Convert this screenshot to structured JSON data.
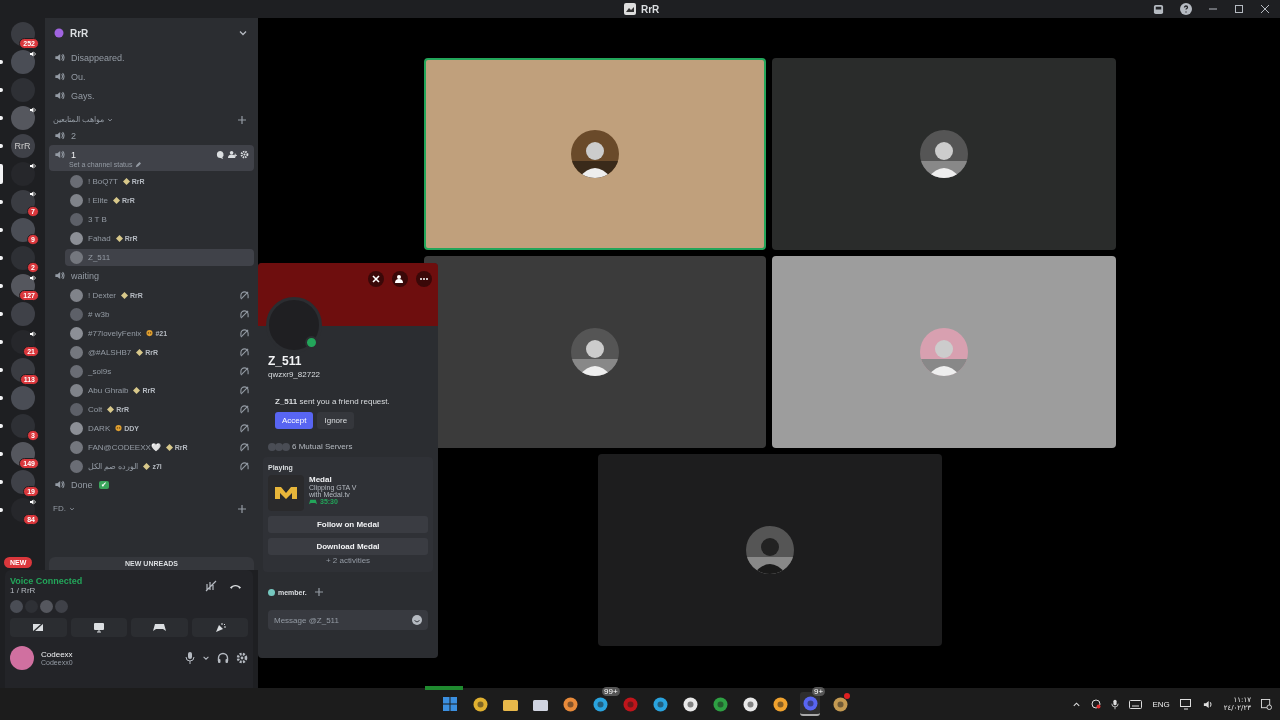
{
  "title_bar": {
    "title": "RrR"
  },
  "servers": [
    {
      "badge": "252",
      "unread": false,
      "selected": false,
      "voice": false
    },
    {
      "unread": true,
      "selected": false,
      "voice": true
    },
    {
      "unread": true,
      "selected": false,
      "voice": false
    },
    {
      "unread": true,
      "selected": false,
      "voice": true
    },
    {
      "text": "RrR",
      "unread": true,
      "selected": false,
      "voice": false
    },
    {
      "unread": false,
      "selected": true,
      "voice": true
    },
    {
      "badge": "7",
      "unread": true,
      "selected": false,
      "voice": true
    },
    {
      "badge": "9",
      "unread": true,
      "selected": false,
      "voice": false
    },
    {
      "badge": "2",
      "unread": true,
      "selected": false,
      "voice": false
    },
    {
      "badge": "127",
      "unread": true,
      "selected": false,
      "voice": true
    },
    {
      "unread": true,
      "selected": false,
      "voice": false
    },
    {
      "badge": "21",
      "unread": true,
      "selected": false,
      "voice": true
    },
    {
      "badge": "113",
      "unread": true,
      "selected": false,
      "voice": false
    },
    {
      "unread": true,
      "selected": false,
      "voice": false
    },
    {
      "badge": "3",
      "unread": true,
      "selected": false,
      "voice": false
    },
    {
      "badge": "149",
      "unread": true,
      "selected": false,
      "voice": false
    },
    {
      "badge": "19",
      "unread": true,
      "selected": false,
      "voice": false
    },
    {
      "badge": "84",
      "unread": true,
      "selected": false,
      "voice": true
    }
  ],
  "new_pill": "NEW",
  "channel_list": {
    "server_name": "RrR",
    "items": [
      {
        "kind": "voice",
        "name": "Disappeared.",
        "selected": false
      },
      {
        "kind": "voice",
        "name": "Ou.",
        "selected": false
      },
      {
        "kind": "voice",
        "name": "Gays.",
        "selected": false
      },
      {
        "kind": "category",
        "name": "مواهب المتابعين"
      },
      {
        "kind": "voice",
        "name": "2",
        "selected": false
      },
      {
        "kind": "voice",
        "name": "1",
        "selected": true,
        "status": "Set a channel status",
        "members": [
          {
            "name": "! BoQ7T",
            "role": {
              "kind": "diamond",
              "label": "RrR"
            },
            "selected": false,
            "deafened": false
          },
          {
            "name": "! Elite",
            "role": {
              "kind": "diamond",
              "label": "RrR"
            },
            "selected": false,
            "deafened": false
          },
          {
            "name": "3 T B",
            "selected": false,
            "deafened": false
          },
          {
            "name": "Fahad",
            "role": {
              "kind": "diamond",
              "label": "RrR"
            },
            "selected": false,
            "deafened": false
          },
          {
            "name": "Z_511",
            "selected": true,
            "deafened": false
          }
        ]
      },
      {
        "kind": "voice",
        "name": "waiting",
        "selected": false,
        "members": [
          {
            "name": "! Dexter",
            "role": {
              "kind": "diamond",
              "label": "RrR"
            },
            "selected": false,
            "deafened": true
          },
          {
            "name": "# w3b",
            "selected": false,
            "deafened": true
          },
          {
            "name": "#77lovelyFenix",
            "role": {
              "kind": "skull",
              "label": "#21"
            },
            "selected": false,
            "deafened": true
          },
          {
            "name": "@#ALSHB7",
            "role": {
              "kind": "diamond",
              "label": "RrR"
            },
            "selected": false,
            "deafened": true
          },
          {
            "name": "_sol9s",
            "selected": false,
            "deafened": true
          },
          {
            "name": "Abu Ghraib",
            "role": {
              "kind": "diamond",
              "label": "RrR"
            },
            "selected": false,
            "deafened": true
          },
          {
            "name": "Colt",
            "role": {
              "kind": "diamond",
              "label": "RrR"
            },
            "selected": false,
            "deafened": true
          },
          {
            "name": "DARK",
            "role": {
              "kind": "skull",
              "label": "DDY"
            },
            "selected": false,
            "deafened": true
          },
          {
            "name": "FAN@CODEEXX🤍",
            "role": {
              "kind": "diamond",
              "label": "RrR"
            },
            "selected": false,
            "deafened": true
          },
          {
            "name": "الورده صم الكل",
            "role": {
              "kind": "diamond",
              "label": "z7l"
            },
            "selected": false,
            "deafened": true
          }
        ]
      },
      {
        "kind": "voice",
        "name": "Done",
        "emoji": "✔",
        "selected": false
      },
      {
        "kind": "category",
        "name": "FD."
      }
    ],
    "new_unreads": "NEW UNREADS"
  },
  "voice_panel": {
    "status": "Voice Connected",
    "channel": "1 / RrR"
  },
  "user_panel": {
    "name": "Codeexx",
    "status": "Codeexx0"
  },
  "profile_popup": {
    "name": "Z_511",
    "username": "qwzxr9_82722",
    "online": true,
    "request_name": "Z_511",
    "request_text": "sent you a friend request.",
    "accept": "Accept",
    "ignore": "Ignore",
    "mutual_servers": "6 Mutual Servers",
    "activity": {
      "heading": "Playing",
      "app": "Medal",
      "details": [
        "Clipping GTA V",
        "with Medal.tv"
      ],
      "elapsed": "35:30"
    },
    "activity_buttons": [
      "Follow on Medal",
      "Download Medal"
    ],
    "more_activities": "+ 2 activities",
    "role": "member.",
    "message_placeholder": "Message @Z_511"
  },
  "stage": {
    "tiles": [
      {
        "color": "#c0a07c",
        "speaking": true
      },
      {
        "color": "#2a2c2b",
        "speaking": false
      },
      {
        "color": "#3b3b3b",
        "speaking": false
      },
      {
        "color": "#9d9d9d",
        "speaking": false
      },
      {
        "color": "#1d1d1e",
        "speaking": false
      }
    ]
  },
  "taskbar": {
    "apps": [
      {
        "kind": "windows",
        "active": false
      },
      {
        "kind": "chrome",
        "active": false
      },
      {
        "kind": "folder",
        "active": false
      },
      {
        "kind": "store",
        "active": false
      },
      {
        "kind": "orange",
        "active": false
      },
      {
        "kind": "telegram",
        "badge": "99+",
        "active": false
      },
      {
        "kind": "red",
        "active": false
      },
      {
        "kind": "telegram",
        "active": false
      },
      {
        "kind": "steam",
        "active": false
      },
      {
        "kind": "xbox",
        "active": false
      },
      {
        "kind": "ring",
        "active": false
      },
      {
        "kind": "yellow",
        "active": false
      },
      {
        "kind": "discord",
        "badge": "9+",
        "active": true
      },
      {
        "kind": "game",
        "alert": true,
        "active": false
      }
    ],
    "language": "ENG",
    "time": "١١:١٧",
    "date": "٢٤/٠٢/٢٣"
  }
}
